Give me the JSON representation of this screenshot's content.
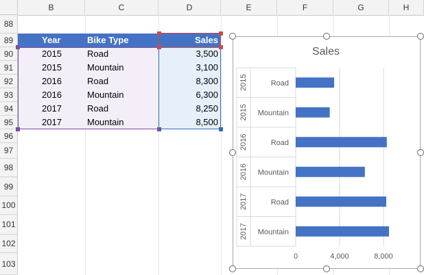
{
  "columns": [
    "B",
    "C",
    "D",
    "E",
    "F",
    "G",
    "H"
  ],
  "rows": [
    "88",
    "89",
    "90",
    "91",
    "92",
    "93",
    "94",
    "95",
    "96",
    "97",
    "98",
    "99",
    "100",
    "101",
    "102",
    "103"
  ],
  "table": {
    "headers": {
      "year": "Year",
      "bike_type": "Bike Type",
      "sales": "Sales"
    },
    "rows": [
      {
        "year": "2015",
        "bike_type": "Road",
        "sales": "3,500"
      },
      {
        "year": "2015",
        "bike_type": "Mountain",
        "sales": "3,100"
      },
      {
        "year": "2016",
        "bike_type": "Road",
        "sales": "8,300"
      },
      {
        "year": "2016",
        "bike_type": "Mountain",
        "sales": "6,300"
      },
      {
        "year": "2017",
        "bike_type": "Road",
        "sales": "8,250"
      },
      {
        "year": "2017",
        "bike_type": "Mountain",
        "sales": "8,500"
      }
    ]
  },
  "colors": {
    "header_fill": "#4472c4",
    "bar": "#4472c4",
    "year_range_fill": "#f3eef8",
    "year_range_border": "#7b4ea0",
    "sales_range_fill": "#e6f0fa",
    "sales_range_border": "#2f6fb5",
    "sales_header_border": "#c0504d"
  },
  "chart_data": {
    "type": "bar",
    "orientation": "horizontal",
    "title": "Sales",
    "categories": [
      {
        "year": "2015",
        "type": "Road"
      },
      {
        "year": "2015",
        "type": "Mountain"
      },
      {
        "year": "2016",
        "type": "Road"
      },
      {
        "year": "2016",
        "type": "Mountain"
      },
      {
        "year": "2017",
        "type": "Road"
      },
      {
        "year": "2017",
        "type": "Mountain"
      }
    ],
    "values": [
      3500,
      3100,
      8300,
      6300,
      8250,
      8500
    ],
    "xlim": [
      0,
      8000
    ],
    "x_ticks": [
      0,
      4000,
      8000
    ],
    "x_tick_labels": [
      "0",
      "4,000",
      "8,000"
    ],
    "grid": true,
    "legend": "none"
  }
}
